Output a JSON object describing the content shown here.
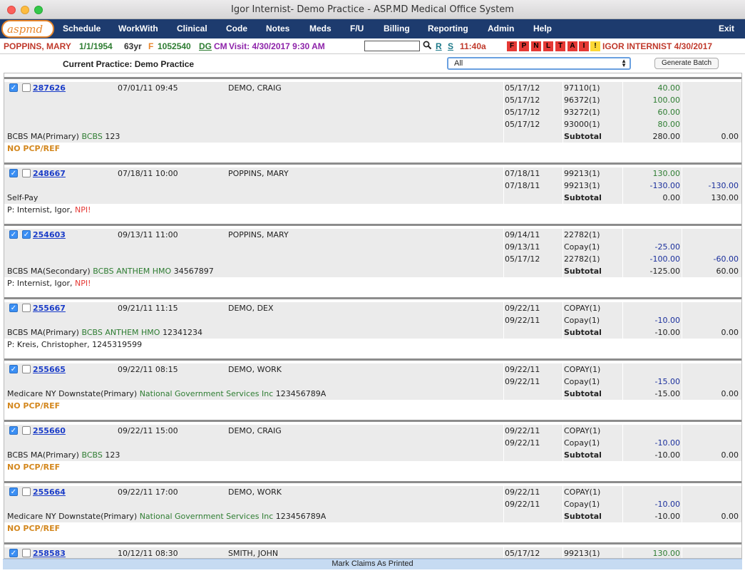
{
  "window": {
    "title": "Igor Internist- Demo Practice - ASP.MD Medical Office System"
  },
  "nav": {
    "logo": "aspmd",
    "items": [
      "Schedule",
      "WorkWith",
      "Clinical",
      "Code",
      "Notes",
      "Meds",
      "F/U",
      "Billing",
      "Reporting",
      "Admin",
      "Help"
    ],
    "exit": "Exit"
  },
  "patient": {
    "name": "POPPINS, MARY",
    "dob": "1/1/1954",
    "age": "63yr",
    "sex": "F",
    "id": "1052540",
    "dg": "DG",
    "cm": "CM",
    "visit": "Visit: 4/30/2017 9:30 AM",
    "search_value": "",
    "r": "R",
    "s": "S",
    "time": "11:40a",
    "flags": [
      "F",
      "P",
      "N",
      "L",
      "T",
      "A",
      "I",
      "!"
    ],
    "user": "IGOR INTERNIST 4/30/2017"
  },
  "practice": {
    "label": "Current Practice: Demo Practice",
    "filter_value": "All",
    "generate_label": "Generate Batch"
  },
  "claims": [
    {
      "id": "287626",
      "checked_a": true,
      "checked_b": false,
      "datetime": "07/01/11 09:45",
      "patient": "DEMO, CRAIG",
      "lines": [
        {
          "date": "05/17/12",
          "code": "97110(1)",
          "charge": "40.00",
          "adj": ""
        },
        {
          "date": "05/17/12",
          "code": "96372(1)",
          "charge": "100.00",
          "adj": ""
        },
        {
          "date": "05/17/12",
          "code": "93272(1)",
          "charge": "60.00",
          "adj": ""
        },
        {
          "date": "05/17/12",
          "code": "93000(1)",
          "charge": "80.00",
          "adj": ""
        }
      ],
      "insurance": "BCBS MA(Primary)",
      "plan": "BCBS",
      "policy": "123",
      "subtotal_label": "Subtotal",
      "subtotal": "280.00",
      "balance": "0.00",
      "provider": "",
      "npi": "",
      "nopcp": "NO PCP/REF"
    },
    {
      "id": "248667",
      "checked_a": true,
      "checked_b": false,
      "datetime": "07/18/11 10:00",
      "patient": "POPPINS, MARY",
      "lines": [
        {
          "date": "07/18/11",
          "code": "99213(1)",
          "charge": "130.00",
          "adj": ""
        },
        {
          "date": "07/18/11",
          "code": "99213(1)",
          "charge": "-130.00",
          "adj": "-130.00"
        }
      ],
      "insurance": "Self-Pay",
      "plan": "",
      "policy": "",
      "subtotal_label": "Subtotal",
      "subtotal": "0.00",
      "balance": "130.00",
      "provider": "P: Internist, Igor,",
      "npi": "NPI!",
      "nopcp": ""
    },
    {
      "id": "254603",
      "checked_a": true,
      "checked_b": true,
      "datetime": "09/13/11 11:00",
      "patient": "POPPINS, MARY",
      "lines": [
        {
          "date": "09/14/11",
          "code": "22782(1)",
          "charge": "",
          "adj": ""
        },
        {
          "date": "09/13/11",
          "code": "Copay(1)",
          "charge": "-25.00",
          "adj": ""
        },
        {
          "date": "05/17/12",
          "code": "22782(1)",
          "charge": "-100.00",
          "adj": "-60.00"
        }
      ],
      "insurance": "BCBS MA(Secondary)",
      "plan": "BCBS ANTHEM HMO",
      "policy": "34567897",
      "subtotal_label": "Subtotal",
      "subtotal": "-125.00",
      "balance": "60.00",
      "provider": "P: Internist, Igor,",
      "npi": "NPI!",
      "nopcp": ""
    },
    {
      "id": "255667",
      "checked_a": true,
      "checked_b": false,
      "datetime": "09/21/11 11:15",
      "patient": "DEMO, DEX",
      "lines": [
        {
          "date": "09/22/11",
          "code": "COPAY(1)",
          "charge": "",
          "adj": ""
        },
        {
          "date": "09/22/11",
          "code": "Copay(1)",
          "charge": "-10.00",
          "adj": ""
        }
      ],
      "insurance": "BCBS MA(Primary)",
      "plan": "BCBS ANTHEM HMO",
      "policy": "12341234",
      "subtotal_label": "Subtotal",
      "subtotal": "-10.00",
      "balance": "0.00",
      "provider": "P: Kreis, Christopher, 1245319599",
      "npi": "",
      "nopcp": ""
    },
    {
      "id": "255665",
      "checked_a": true,
      "checked_b": false,
      "datetime": "09/22/11 08:15",
      "patient": "DEMO, WORK",
      "lines": [
        {
          "date": "09/22/11",
          "code": "COPAY(1)",
          "charge": "",
          "adj": ""
        },
        {
          "date": "09/22/11",
          "code": "Copay(1)",
          "charge": "-15.00",
          "adj": ""
        }
      ],
      "insurance": "Medicare NY Downstate(Primary)",
      "plan": "National Government Services Inc",
      "policy": "123456789A",
      "subtotal_label": "Subtotal",
      "subtotal": "-15.00",
      "balance": "0.00",
      "provider": "",
      "npi": "",
      "nopcp": "NO PCP/REF"
    },
    {
      "id": "255660",
      "checked_a": true,
      "checked_b": false,
      "datetime": "09/22/11 15:00",
      "patient": "DEMO, CRAIG",
      "lines": [
        {
          "date": "09/22/11",
          "code": "COPAY(1)",
          "charge": "",
          "adj": ""
        },
        {
          "date": "09/22/11",
          "code": "Copay(1)",
          "charge": "-10.00",
          "adj": ""
        }
      ],
      "insurance": "BCBS MA(Primary)",
      "plan": "BCBS",
      "policy": "123",
      "subtotal_label": "Subtotal",
      "subtotal": "-10.00",
      "balance": "0.00",
      "provider": "",
      "npi": "",
      "nopcp": "NO PCP/REF"
    },
    {
      "id": "255664",
      "checked_a": true,
      "checked_b": false,
      "datetime": "09/22/11 17:00",
      "patient": "DEMO, WORK",
      "lines": [
        {
          "date": "09/22/11",
          "code": "COPAY(1)",
          "charge": "",
          "adj": ""
        },
        {
          "date": "09/22/11",
          "code": "Copay(1)",
          "charge": "-10.00",
          "adj": ""
        }
      ],
      "insurance": "Medicare NY Downstate(Primary)",
      "plan": "National Government Services Inc",
      "policy": "123456789A",
      "subtotal_label": "Subtotal",
      "subtotal": "-10.00",
      "balance": "0.00",
      "provider": "",
      "npi": "",
      "nopcp": "NO PCP/REF"
    },
    {
      "id": "258583",
      "checked_a": true,
      "checked_b": false,
      "datetime": "10/12/11 08:30",
      "patient": "SMITH, JOHN",
      "lines": [
        {
          "date": "05/17/12",
          "code": "99213(1)",
          "charge": "130.00",
          "adj": ""
        }
      ],
      "insurance": "",
      "plan": "",
      "policy": "",
      "subtotal_label": "",
      "subtotal": "",
      "balance": "",
      "provider": "",
      "npi": "",
      "nopcp": ""
    }
  ],
  "bottom": {
    "mark_label": "Mark Claims As Printed"
  }
}
